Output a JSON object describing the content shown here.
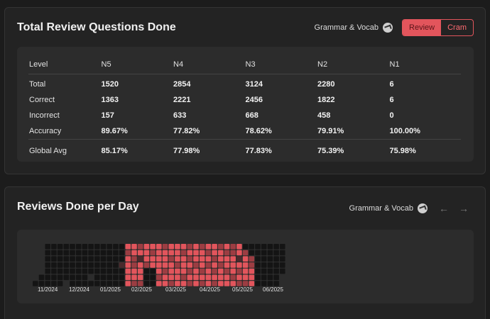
{
  "panel1": {
    "title": "Total Review Questions Done",
    "filter_label": "Grammar & Vocab",
    "toggle": [
      "Review",
      "Cram"
    ],
    "active_toggle": "Review"
  },
  "table": {
    "headers": [
      "Level",
      "N5",
      "N4",
      "N3",
      "N2",
      "N1"
    ],
    "rows": [
      {
        "label": "Total",
        "values": [
          "1520",
          "2854",
          "3124",
          "2280",
          "6"
        ]
      },
      {
        "label": "Correct",
        "values": [
          "1363",
          "2221",
          "2456",
          "1822",
          "6"
        ]
      },
      {
        "label": "Incorrect",
        "values": [
          "157",
          "633",
          "668",
          "458",
          "0"
        ]
      },
      {
        "label": "Accuracy",
        "values": [
          "89.67%",
          "77.82%",
          "78.62%",
          "79.91%",
          "100.00%"
        ]
      }
    ],
    "avg": {
      "label": "Global Avg",
      "values": [
        "85.17%",
        "77.98%",
        "77.83%",
        "75.39%",
        "75.98%"
      ]
    }
  },
  "panel2": {
    "title": "Reviews Done per Day",
    "filter_label": "Grammar & Vocab",
    "prev_icon": "arrow-left-icon",
    "next_icon": "arrow-right-icon"
  },
  "chart_data": {
    "type": "heatmap",
    "months": [
      "11/2024",
      "12/2024",
      "01/2025",
      "02/2025",
      "03/2025",
      "04/2025",
      "05/2025",
      "06/2025"
    ],
    "rows": 7,
    "colors": {
      "empty": "#141414",
      "low": "#4a2a2c",
      "mid": "#9c3d42",
      "high": "#e2555c"
    },
    "columns": [
      [
        "",
        "",
        "",
        "",
        "",
        "",
        "e"
      ],
      [
        "",
        "",
        "",
        "",
        "",
        "e",
        "e"
      ],
      [
        "e",
        "e",
        "e",
        "e",
        "e",
        "e",
        "e"
      ],
      [
        "e",
        "e",
        "e",
        "e",
        "e",
        "e",
        "e"
      ],
      [
        "e",
        "e",
        "e",
        "e",
        "e",
        "e",
        "e"
      ],
      [
        "e",
        "e",
        "e",
        "e",
        "e",
        "e",
        ""
      ],
      [
        "e",
        "e",
        "e",
        "e",
        "e",
        "e",
        "e"
      ],
      [
        "e",
        "e",
        "e",
        "e",
        "e",
        "e",
        "e"
      ],
      [
        "e",
        "e",
        "e",
        "e",
        "e",
        "e",
        "e"
      ],
      [
        "e",
        "e",
        "e",
        "e",
        "e",
        "",
        "e"
      ],
      [
        "e",
        "e",
        "e",
        "e",
        "e",
        "e",
        "e"
      ],
      [
        "e",
        "e",
        "e",
        "e",
        "e",
        "e",
        "e"
      ],
      [
        "e",
        "e",
        "e",
        "e",
        "e",
        "e",
        "e"
      ],
      [
        "e",
        "e",
        "e",
        "e",
        "e",
        "e",
        "e"
      ],
      [
        "e",
        "e",
        "e",
        "l",
        "e",
        "e",
        "e"
      ],
      [
        "h",
        "m",
        "h",
        "h",
        "h",
        "h",
        "h"
      ],
      [
        "h",
        "h",
        "m",
        "m",
        "h",
        "h",
        "m"
      ],
      [
        "m",
        "h",
        "l",
        "h",
        "h",
        "h",
        "m"
      ],
      [
        "h",
        "h",
        "h",
        "m",
        "e",
        "e",
        "e"
      ],
      [
        "h",
        "m",
        "h",
        "h",
        "e",
        "e",
        "e"
      ],
      [
        "h",
        "h",
        "h",
        "h",
        "h",
        "m",
        "h"
      ],
      [
        "m",
        "h",
        "h",
        "h",
        "m",
        "h",
        "h"
      ],
      [
        "h",
        "h",
        "m",
        "h",
        "h",
        "h",
        "m"
      ],
      [
        "h",
        "h",
        "h",
        "m",
        "h",
        "h",
        "h"
      ],
      [
        "h",
        "m",
        "h",
        "h",
        "h",
        "m",
        "h"
      ],
      [
        "m",
        "h",
        "m",
        "h",
        "m",
        "h",
        "m"
      ],
      [
        "h",
        "h",
        "h",
        "m",
        "h",
        "h",
        "h"
      ],
      [
        "m",
        "h",
        "h",
        "h",
        "m",
        "h",
        "m"
      ],
      [
        "h",
        "m",
        "h",
        "m",
        "h",
        "h",
        "h"
      ],
      [
        "h",
        "h",
        "m",
        "h",
        "m",
        "h",
        "m"
      ],
      [
        "m",
        "h",
        "h",
        "m",
        "h",
        "h",
        "h"
      ],
      [
        "h",
        "m",
        "h",
        "h",
        "m",
        "h",
        "h"
      ],
      [
        "m",
        "m",
        "h",
        "h",
        "h",
        "m",
        "h"
      ],
      [
        "h",
        "h",
        "l",
        "h",
        "m",
        "h",
        "m"
      ],
      [
        "e",
        "m",
        "h",
        "h",
        "h",
        "h",
        "m"
      ],
      [
        "e",
        "e",
        "m",
        "m",
        "h",
        "h",
        "h"
      ],
      [
        "e",
        "e",
        "e",
        "e",
        "e",
        "e",
        "e"
      ],
      [
        "e",
        "e",
        "e",
        "e",
        "e",
        "e",
        "e"
      ],
      [
        "e",
        "e",
        "e",
        "e",
        "e",
        "e",
        "e"
      ],
      [
        "e",
        "e",
        "e",
        "e",
        "e",
        "e",
        "e"
      ],
      [
        "e",
        "e",
        "e",
        "e",
        "e",
        "",
        ""
      ]
    ]
  }
}
